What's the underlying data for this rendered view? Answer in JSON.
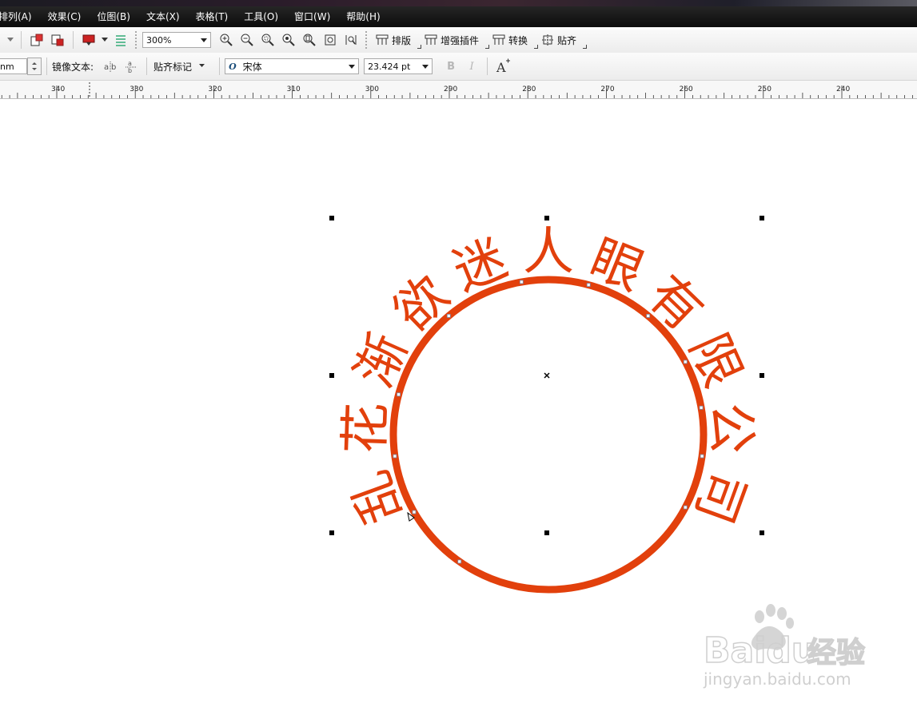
{
  "menu": {
    "items": [
      "排列(A)",
      "效果(C)",
      "位图(B)",
      "文本(X)",
      "表格(T)",
      "工具(O)",
      "窗口(W)",
      "帮助(H)"
    ]
  },
  "toolbar1": {
    "zoom_value": "300%",
    "layout_label": "排版",
    "enhance_label": "增强插件",
    "convert_label": "转换",
    "snap_label": "贴齐"
  },
  "toolbar2": {
    "offset_value": "nm",
    "mirror_label": "镜像文本:",
    "snap_mark_label": "贴齐标记",
    "font_name": "宋体",
    "font_size": "23.424 pt"
  },
  "ruler": {
    "labels": [
      "340",
      "330",
      "320",
      "310",
      "300",
      "290",
      "280",
      "270",
      "260",
      "250",
      "240"
    ]
  },
  "canvas": {
    "arc_text": [
      "乱",
      "花",
      "渐",
      "欲",
      "迷",
      "人",
      "眼",
      "有",
      "限",
      "公",
      "司"
    ],
    "accent_color": "#e2400c"
  },
  "watermark": {
    "brand": "Baidu",
    "brand_cn": "经验",
    "url": "jingyan.baidu.com"
  }
}
